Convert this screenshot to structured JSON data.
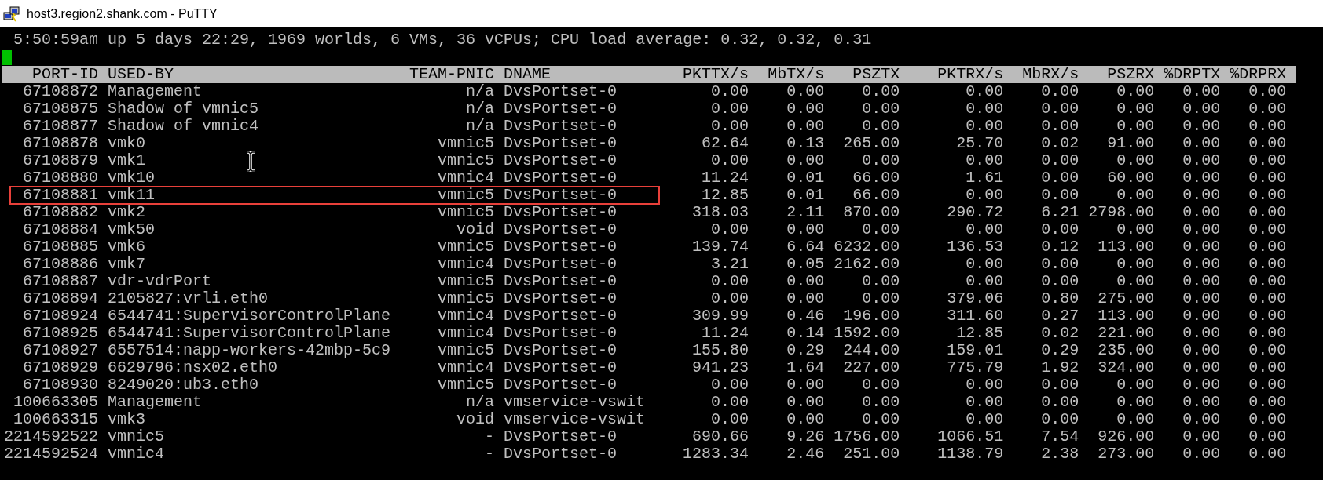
{
  "window": {
    "title": "host3.region2.shank.com - PuTTY"
  },
  "terminal": {
    "status_line": "5:50:59am up 5 days 22:29, 1969 worlds, 6 VMs, 36 vCPUs; CPU load average: 0.32, 0.32, 0.31",
    "cursor_visible": true
  },
  "table": {
    "columns": [
      "PORT-ID",
      "USED-BY",
      "TEAM-PNIC",
      "DNAME",
      "PKTTX/s",
      "MbTX/s",
      "PSZTX",
      "PKTRX/s",
      "MbRX/s",
      "PSZRX",
      "%DRPTX",
      "%DRPRX"
    ],
    "rows": [
      {
        "cells": [
          "67108872",
          "Management",
          "n/a",
          "DvsPortset-0",
          "0.00",
          "0.00",
          "0.00",
          "0.00",
          "0.00",
          "0.00",
          "0.00",
          "0.00"
        ],
        "highlighted": false
      },
      {
        "cells": [
          "67108875",
          "Shadow of vmnic5",
          "n/a",
          "DvsPortset-0",
          "0.00",
          "0.00",
          "0.00",
          "0.00",
          "0.00",
          "0.00",
          "0.00",
          "0.00"
        ],
        "highlighted": false
      },
      {
        "cells": [
          "67108877",
          "Shadow of vmnic4",
          "n/a",
          "DvsPortset-0",
          "0.00",
          "0.00",
          "0.00",
          "0.00",
          "0.00",
          "0.00",
          "0.00",
          "0.00"
        ],
        "highlighted": false
      },
      {
        "cells": [
          "67108878",
          "vmk0",
          "vmnic5",
          "DvsPortset-0",
          "62.64",
          "0.13",
          "265.00",
          "25.70",
          "0.02",
          "91.00",
          "0.00",
          "0.00"
        ],
        "highlighted": false
      },
      {
        "cells": [
          "67108879",
          "vmk1",
          "vmnic5",
          "DvsPortset-0",
          "0.00",
          "0.00",
          "0.00",
          "0.00",
          "0.00",
          "0.00",
          "0.00",
          "0.00"
        ],
        "highlighted": false
      },
      {
        "cells": [
          "67108880",
          "vmk10",
          "vmnic4",
          "DvsPortset-0",
          "11.24",
          "0.01",
          "66.00",
          "1.61",
          "0.00",
          "60.00",
          "0.00",
          "0.00"
        ],
        "highlighted": false
      },
      {
        "cells": [
          "67108881",
          "vmk11",
          "vmnic5",
          "DvsPortset-0",
          "12.85",
          "0.01",
          "66.00",
          "0.00",
          "0.00",
          "0.00",
          "0.00",
          "0.00"
        ],
        "highlighted": true
      },
      {
        "cells": [
          "67108882",
          "vmk2",
          "vmnic5",
          "DvsPortset-0",
          "318.03",
          "2.11",
          "870.00",
          "290.72",
          "6.21",
          "2798.00",
          "0.00",
          "0.00"
        ],
        "highlighted": false
      },
      {
        "cells": [
          "67108884",
          "vmk50",
          "void",
          "DvsPortset-0",
          "0.00",
          "0.00",
          "0.00",
          "0.00",
          "0.00",
          "0.00",
          "0.00",
          "0.00"
        ],
        "highlighted": false
      },
      {
        "cells": [
          "67108885",
          "vmk6",
          "vmnic5",
          "DvsPortset-0",
          "139.74",
          "6.64",
          "6232.00",
          "136.53",
          "0.12",
          "113.00",
          "0.00",
          "0.00"
        ],
        "highlighted": false
      },
      {
        "cells": [
          "67108886",
          "vmk7",
          "vmnic4",
          "DvsPortset-0",
          "3.21",
          "0.05",
          "2162.00",
          "0.00",
          "0.00",
          "0.00",
          "0.00",
          "0.00"
        ],
        "highlighted": false
      },
      {
        "cells": [
          "67108887",
          "vdr-vdrPort",
          "vmnic5",
          "DvsPortset-0",
          "0.00",
          "0.00",
          "0.00",
          "0.00",
          "0.00",
          "0.00",
          "0.00",
          "0.00"
        ],
        "highlighted": false
      },
      {
        "cells": [
          "67108894",
          "2105827:vrli.eth0",
          "vmnic5",
          "DvsPortset-0",
          "0.00",
          "0.00",
          "0.00",
          "379.06",
          "0.80",
          "275.00",
          "0.00",
          "0.00"
        ],
        "highlighted": false
      },
      {
        "cells": [
          "67108924",
          "6544741:SupervisorControlPlane",
          "vmnic4",
          "DvsPortset-0",
          "309.99",
          "0.46",
          "196.00",
          "311.60",
          "0.27",
          "113.00",
          "0.00",
          "0.00"
        ],
        "highlighted": false
      },
      {
        "cells": [
          "67108925",
          "6544741:SupervisorControlPlane",
          "vmnic4",
          "DvsPortset-0",
          "11.24",
          "0.14",
          "1592.00",
          "12.85",
          "0.02",
          "221.00",
          "0.00",
          "0.00"
        ],
        "highlighted": false
      },
      {
        "cells": [
          "67108927",
          "6557514:napp-workers-42mbp-5c9",
          "vmnic5",
          "DvsPortset-0",
          "155.80",
          "0.29",
          "244.00",
          "159.01",
          "0.29",
          "235.00",
          "0.00",
          "0.00"
        ],
        "highlighted": false
      },
      {
        "cells": [
          "67108929",
          "6629796:nsx02.eth0",
          "vmnic4",
          "DvsPortset-0",
          "941.23",
          "1.64",
          "227.00",
          "775.79",
          "1.92",
          "324.00",
          "0.00",
          "0.00"
        ],
        "highlighted": false
      },
      {
        "cells": [
          "67108930",
          "8249020:ub3.eth0",
          "vmnic5",
          "DvsPortset-0",
          "0.00",
          "0.00",
          "0.00",
          "0.00",
          "0.00",
          "0.00",
          "0.00",
          "0.00"
        ],
        "highlighted": false
      },
      {
        "cells": [
          "100663305",
          "Management",
          "n/a",
          "vmservice-vswit",
          "0.00",
          "0.00",
          "0.00",
          "0.00",
          "0.00",
          "0.00",
          "0.00",
          "0.00"
        ],
        "highlighted": false
      },
      {
        "cells": [
          "100663315",
          "vmk3",
          "void",
          "vmservice-vswit",
          "0.00",
          "0.00",
          "0.00",
          "0.00",
          "0.00",
          "0.00",
          "0.00",
          "0.00"
        ],
        "highlighted": false
      },
      {
        "cells": [
          "2214592522",
          "vmnic5",
          "-",
          "DvsPortset-0",
          "690.66",
          "9.26",
          "1756.00",
          "1066.51",
          "7.54",
          "926.00",
          "0.00",
          "0.00"
        ],
        "highlighted": false
      },
      {
        "cells": [
          "2214592524",
          "vmnic4",
          "-",
          "DvsPortset-0",
          "1283.34",
          "2.46",
          "251.00",
          "1138.79",
          "2.38",
          "273.00",
          "0.00",
          "0.00"
        ],
        "highlighted": false
      }
    ]
  }
}
